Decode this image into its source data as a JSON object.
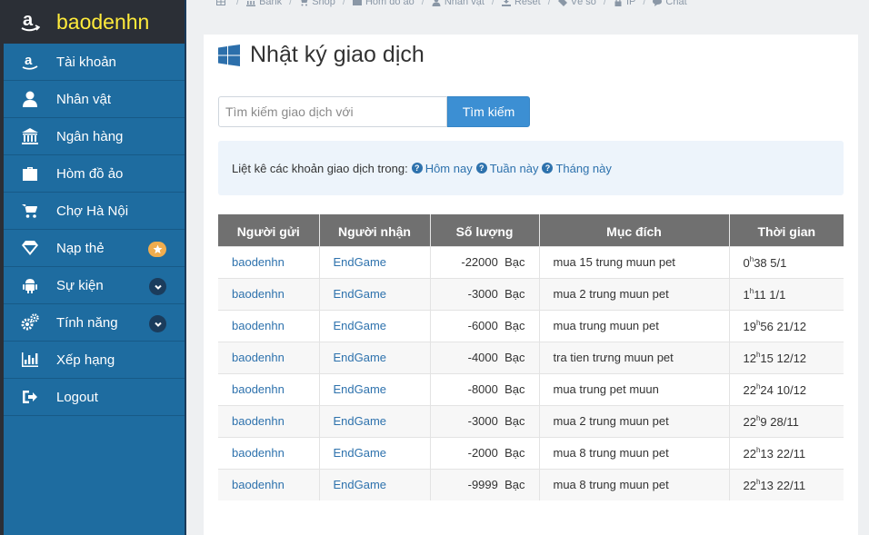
{
  "brand": {
    "name": "baodenhn",
    "icon": "amazon-icon"
  },
  "sidebar": {
    "items": [
      {
        "label": "Tài khoản",
        "icon": "amazon-icon"
      },
      {
        "label": "Nhân vật",
        "icon": "user-icon"
      },
      {
        "label": "Ngân hàng",
        "icon": "bank-icon"
      },
      {
        "label": "Hòm đồ ảo",
        "icon": "briefcase-icon"
      },
      {
        "label": "Chợ Hà Nội",
        "icon": "cart-icon"
      },
      {
        "label": "Nạp thẻ",
        "icon": "diamond-icon",
        "badge": "star-icon"
      },
      {
        "label": "Sự kiện",
        "icon": "android-icon",
        "chevron": true
      },
      {
        "label": "Tính năng",
        "icon": "cogs-icon",
        "chevron": true
      },
      {
        "label": "Xếp hạng",
        "icon": "bar-chart-icon"
      },
      {
        "label": "Logout",
        "icon": "sign-out-icon"
      }
    ]
  },
  "breadcrumb": [
    {
      "label": "",
      "icon": "table-icon"
    },
    {
      "label": "Bank",
      "icon": "bank-icon"
    },
    {
      "label": "Shop",
      "icon": "cart-icon"
    },
    {
      "label": "Hòm đồ ảo",
      "icon": "briefcase-icon"
    },
    {
      "label": "Nhân vật",
      "icon": "user-icon"
    },
    {
      "label": "Reset",
      "icon": "download-icon"
    },
    {
      "label": "Vé số",
      "icon": "ticket-icon"
    },
    {
      "label": "IP",
      "icon": "lock-icon"
    },
    {
      "label": "Chat",
      "icon": "comment-icon"
    }
  ],
  "page": {
    "title": "Nhật ký giao dịch",
    "title_icon": "windows-icon"
  },
  "search": {
    "placeholder": "Tìm kiếm giao dịch với",
    "value": "",
    "button": "Tìm kiếm"
  },
  "info": {
    "prefix": "Liệt kê các khoản giao dịch trong:",
    "links": [
      "Hôm nay",
      "Tuần này",
      "Tháng này"
    ]
  },
  "table": {
    "headers": [
      "Người gửi",
      "Người nhận",
      "Số lượng",
      "Mục đích",
      "Thời gian"
    ],
    "rows": [
      {
        "sender": "baodenhn",
        "receiver": "EndGame",
        "amount": "-22000",
        "unit": "Bạc",
        "purpose": "mua 15 trung muun pet",
        "hour": "0",
        "time": "38 5/1"
      },
      {
        "sender": "baodenhn",
        "receiver": "EndGame",
        "amount": "-3000",
        "unit": "Bạc",
        "purpose": "mua 2 trung muun pet",
        "hour": "1",
        "time": "11 1/1"
      },
      {
        "sender": "baodenhn",
        "receiver": "EndGame",
        "amount": "-6000",
        "unit": "Bạc",
        "purpose": "mua trung muun pet",
        "hour": "19",
        "time": "56 21/12"
      },
      {
        "sender": "baodenhn",
        "receiver": "EndGame",
        "amount": "-4000",
        "unit": "Bạc",
        "purpose": "tra tien trưng muun pet",
        "hour": "12",
        "time": "15 12/12"
      },
      {
        "sender": "baodenhn",
        "receiver": "EndGame",
        "amount": "-8000",
        "unit": "Bạc",
        "purpose": "mua trung pet muun",
        "hour": "22",
        "time": "24 10/12"
      },
      {
        "sender": "baodenhn",
        "receiver": "EndGame",
        "amount": "-3000",
        "unit": "Bạc",
        "purpose": "mua 2 trung muun pet",
        "hour": "22",
        "time": "9 28/11"
      },
      {
        "sender": "baodenhn",
        "receiver": "EndGame",
        "amount": "-2000",
        "unit": "Bạc",
        "purpose": "mua 8 trung muun pet",
        "hour": "22",
        "time": "13 22/11"
      },
      {
        "sender": "baodenhn",
        "receiver": "EndGame",
        "amount": "-9999",
        "unit": "Bạc",
        "purpose": "mua 8 trung muun pet",
        "hour": "22",
        "time": "13 22/11"
      }
    ]
  },
  "colors": {
    "sidebar": "#1e6ca0",
    "brand_bg": "#2b2f36",
    "brand_text": "#ffeb3b",
    "accent": "#3c8fd3",
    "table_header": "#707070",
    "link": "#2e72ad"
  }
}
